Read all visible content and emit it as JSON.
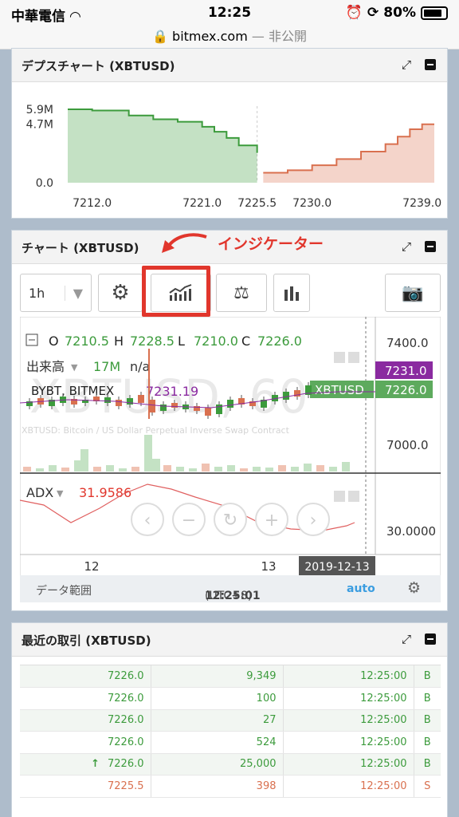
{
  "status_bar": {
    "carrier": "中華電信",
    "time": "12:25",
    "battery": "80%"
  },
  "browser": {
    "url": "bitmex.com",
    "url_suffix": "— 非公開"
  },
  "depth_panel": {
    "title": "デプスチャート (XBTUSD)",
    "chart_data": {
      "type": "area",
      "title": "",
      "y_ticks": [
        "5.9M",
        "4.7M",
        "0.0"
      ],
      "x_ticks": [
        "7212.0",
        "7221.0",
        "7225.5",
        "7230.0",
        "7239.0"
      ],
      "ylim": [
        0,
        5.9
      ],
      "xlim": [
        7210.0,
        7240.0
      ],
      "mid": 7225.5,
      "series": [
        {
          "side": "bid",
          "color": "#3c9b3c",
          "x": [
            7210.0,
            7212.0,
            7215.0,
            7217.0,
            7219.0,
            7221.0,
            7222.0,
            7223.0,
            7224.0,
            7225.5
          ],
          "y": [
            5.9,
            5.8,
            5.4,
            5.1,
            4.9,
            4.5,
            4.1,
            3.6,
            3.0,
            2.4
          ]
        },
        {
          "side": "ask",
          "color": "#d9704f",
          "x": [
            7226.0,
            7228.0,
            7230.0,
            7232.0,
            7234.0,
            7236.0,
            7237.0,
            7238.0,
            7239.0,
            7240.0
          ],
          "y": [
            0.8,
            1.0,
            1.4,
            1.9,
            2.5,
            3.1,
            3.7,
            4.3,
            4.7,
            4.7
          ]
        }
      ]
    }
  },
  "chart_panel": {
    "title": "チャート (XBTUSD)",
    "annotation": "インジケーター",
    "interval": "1h",
    "ohlc": {
      "o_label": "O",
      "o": "7210.5",
      "h_label": "H",
      "h": "7228.5",
      "l_label": "L",
      "l": "7210.0",
      "c_label": "C",
      "c": "7226.0"
    },
    "volume_label": "出来高",
    "volume_value": "17M",
    "volume_na": "n/a",
    "exchanges": "BYBT, BITMEX",
    "exchange_value": "7231.19",
    "watermark": "XBTUSD, 60",
    "subtitle": "XBTUSD: Bitcoin / US Dollar Perpetual Inverse Swap Contract",
    "price_ticks": [
      "7400.0",
      "7000.0"
    ],
    "price_badge_purple": "7231.0",
    "price_badge_green": "7226.0",
    "symbol_badge": "XBTUSD",
    "adx_label": "ADX",
    "adx_value": "31.9586",
    "adx_tick": "30.0000",
    "x_ticks": [
      "12",
      "13"
    ],
    "date_badge": "2019-12-13",
    "footer": {
      "range": "データ範囲",
      "time": "12:25:01",
      "tz": "(UTC+8)",
      "auto": "auto"
    },
    "colors": {
      "up": "#3c9b3c",
      "down": "#d9704f",
      "purple": "#8a2aa0",
      "red": "#e1362c"
    }
  },
  "trades_panel": {
    "title": "最近の取引 (XBTUSD)",
    "rows": [
      {
        "price": "7226.0",
        "size": "9,349",
        "time": "12:25:00",
        "side": "B",
        "arrow": ""
      },
      {
        "price": "7226.0",
        "size": "100",
        "time": "12:25:00",
        "side": "B",
        "arrow": ""
      },
      {
        "price": "7226.0",
        "size": "27",
        "time": "12:25:00",
        "side": "B",
        "arrow": ""
      },
      {
        "price": "7226.0",
        "size": "524",
        "time": "12:25:00",
        "side": "B",
        "arrow": ""
      },
      {
        "price": "7226.0",
        "size": "25,000",
        "time": "12:25:00",
        "side": "B",
        "arrow": "↑"
      },
      {
        "price": "7225.5",
        "size": "398",
        "time": "12:25:00",
        "side": "S",
        "arrow": ""
      }
    ]
  }
}
